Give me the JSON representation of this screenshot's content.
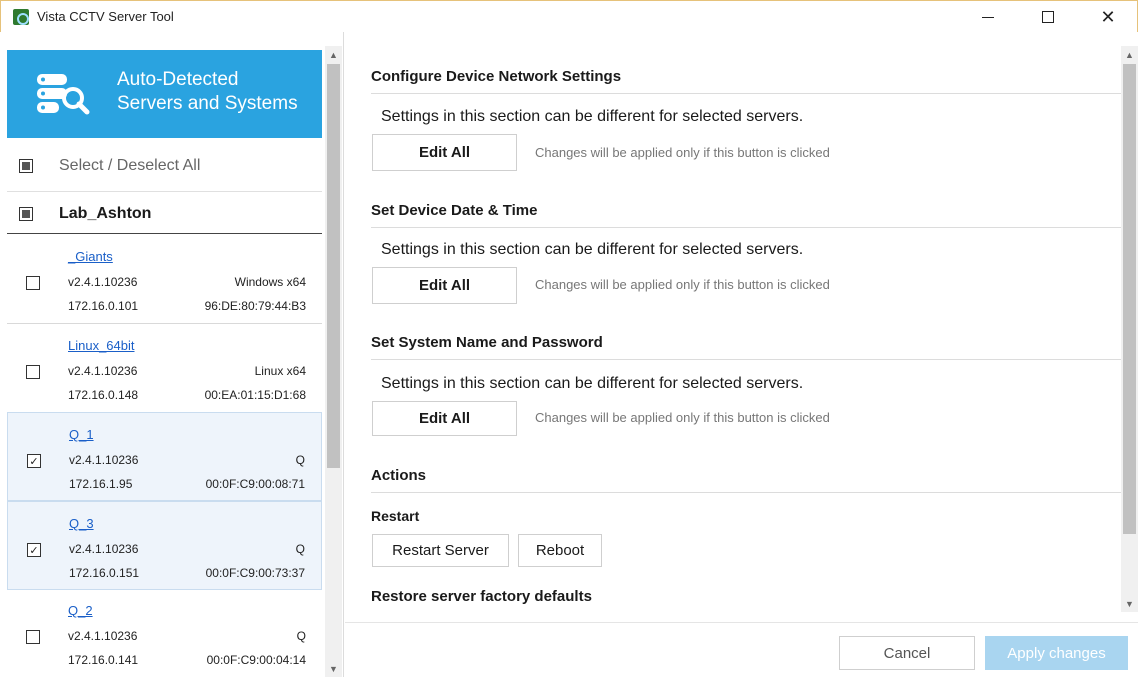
{
  "window": {
    "title": "Vista CCTV Server Tool"
  },
  "sidebar": {
    "header_line1": "Auto-Detected",
    "header_line2": "Servers and Systems",
    "select_all_label": "Select / Deselect All",
    "group_label": "Lab_Ashton",
    "servers": [
      {
        "name": "_Giants",
        "version": "v2.4.1.10236",
        "os": "Windows x64",
        "ip": "172.16.0.101",
        "mac": "96:DE:80:79:44:B3",
        "checked": false
      },
      {
        "name": "Linux_64bit",
        "version": "v2.4.1.10236",
        "os": "Linux x64",
        "ip": "172.16.0.148",
        "mac": "00:EA:01:15:D1:68",
        "checked": false
      },
      {
        "name": "Q_1",
        "version": "v2.4.1.10236",
        "os": "Q",
        "ip": "172.16.1.95",
        "mac": "00:0F:C9:00:08:71",
        "checked": true
      },
      {
        "name": "Q_3",
        "version": "v2.4.1.10236",
        "os": "Q",
        "ip": "172.16.0.151",
        "mac": "00:0F:C9:00:73:37",
        "checked": true
      },
      {
        "name": "Q_2",
        "version": "v2.4.1.10236",
        "os": "Q",
        "ip": "172.16.0.141",
        "mac": "00:0F:C9:00:04:14",
        "checked": false
      }
    ],
    "check_mark": "✓"
  },
  "main": {
    "sections": [
      {
        "title": "Configure Device Network Settings",
        "desc": "Settings in this section can be different for selected servers.",
        "button": "Edit All",
        "hint": "Changes will be applied only if this button is clicked"
      },
      {
        "title": "Set Device Date & Time",
        "desc": "Settings in this section can be different for selected servers.",
        "button": "Edit All",
        "hint": "Changes will be applied only if this button is clicked"
      },
      {
        "title": "Set System Name and Password",
        "desc": "Settings in this section can be different for selected servers.",
        "button": "Edit All",
        "hint": "Changes will be applied only if this button is clicked"
      }
    ],
    "actions_title": "Actions",
    "restart_label": "Restart",
    "restart_server_button": "Restart Server",
    "reboot_button": "Reboot",
    "restore_label": "Restore server factory defaults"
  },
  "footer": {
    "cancel_button": "Cancel",
    "apply_button": "Apply changes"
  },
  "colors": {
    "accent": "#2aa3e0",
    "apply_disabled": "#a9d5f0",
    "link": "#1a5fc8"
  }
}
